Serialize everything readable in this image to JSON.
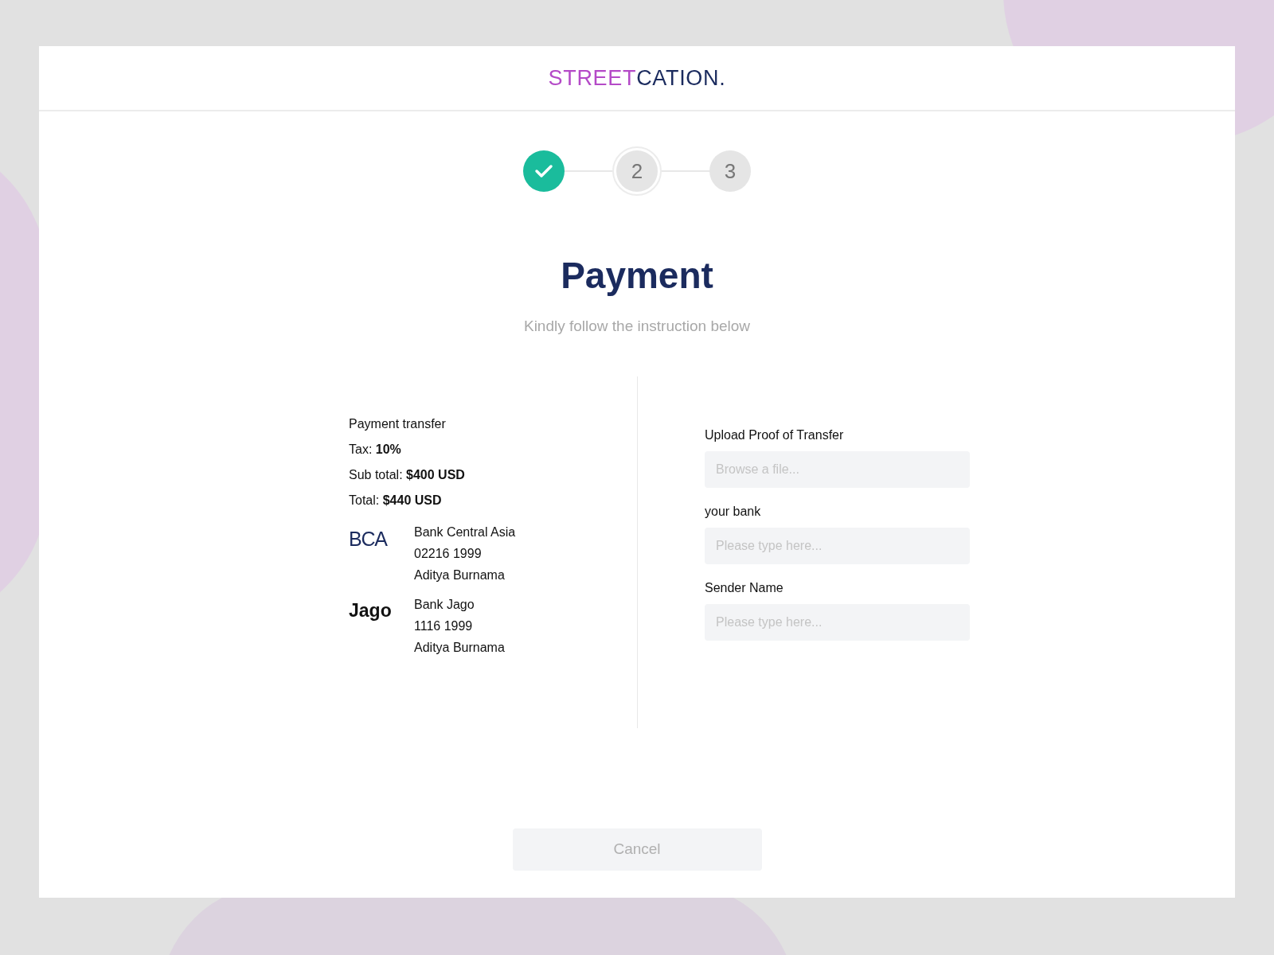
{
  "logo": {
    "first": "STREET",
    "second": "CATION."
  },
  "steps": [
    {
      "done": true,
      "selected": false
    },
    {
      "label": "2",
      "done": false,
      "selected": true
    },
    {
      "label": "3",
      "done": false,
      "selected": false
    }
  ],
  "title": "Payment",
  "subtitle": "Kindly follow the instruction below",
  "summary": [
    "Payment transfer",
    "Tax: **10%**",
    "Sub total: **$400 USD**",
    "Total: **$440 USD**"
  ],
  "banks": [
    {
      "logo": "BCA",
      "kind": "condensed",
      "lines": [
        "Bank Central Asia",
        "02216 1999",
        "Aditya Burnama"
      ]
    },
    {
      "logo": "Jago",
      "kind": "bold",
      "lines": [
        "Bank Jago",
        "1116 1999",
        "Aditya Burnama"
      ]
    }
  ],
  "fields": [
    {
      "label": "Upload Proof of Transfer",
      "placeholder": "Browse a file..."
    },
    {
      "label": "your bank",
      "placeholder": "Please type here..."
    },
    {
      "label": "Sender Name",
      "placeholder": "Please type here..."
    }
  ],
  "cancel_button": "Cancel"
}
